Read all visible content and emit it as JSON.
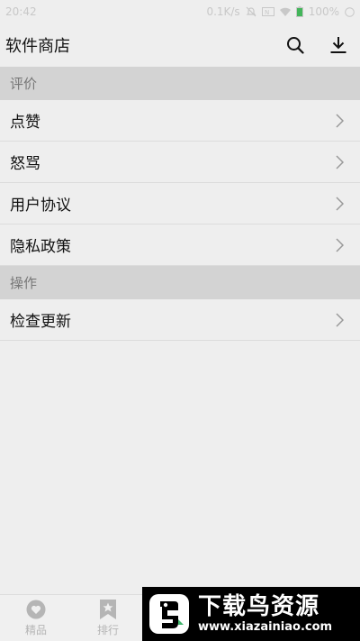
{
  "status_bar": {
    "time": "20:42",
    "speed": "0.1K/s",
    "battery": "100%"
  },
  "app_bar": {
    "title": "软件商店",
    "actions": [
      "search-icon",
      "download-icon"
    ]
  },
  "sections": [
    {
      "header": "评价",
      "items": [
        {
          "label": "点赞"
        },
        {
          "label": "怒骂"
        },
        {
          "label": "用户协议"
        },
        {
          "label": "隐私政策"
        }
      ]
    },
    {
      "header": "操作",
      "items": [
        {
          "label": "检查更新"
        }
      ]
    }
  ],
  "tabbar": {
    "tabs": [
      {
        "label": "精品",
        "icon": "heart-icon"
      },
      {
        "label": "排行",
        "icon": "bookmark-star-icon"
      }
    ]
  },
  "watermark": {
    "title": "下载鸟资源",
    "url": "www.xiazainiao.com"
  },
  "colors": {
    "background": "#eeeeee",
    "section_header": "#d3d3d3",
    "watermark": "#000000"
  }
}
